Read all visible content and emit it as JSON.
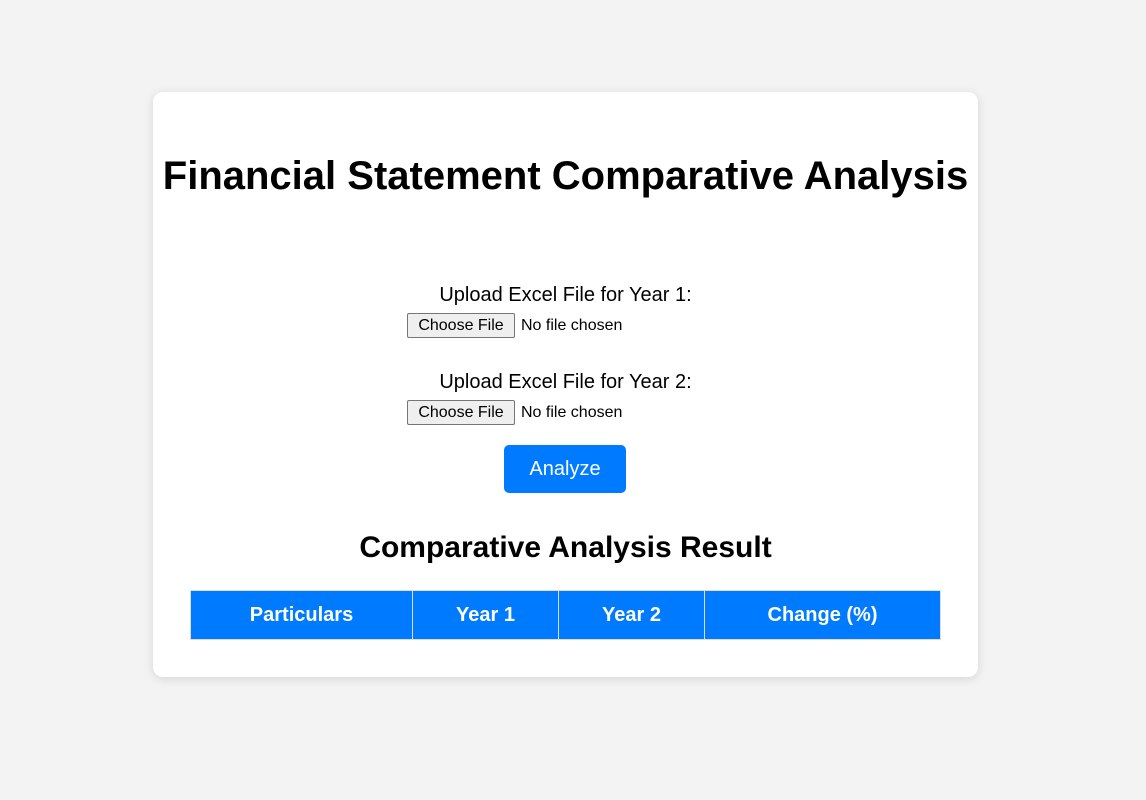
{
  "page": {
    "title": "Financial Statement Comparative Analysis"
  },
  "uploads": [
    {
      "label": "Upload Excel File for Year 1:",
      "button_label": "Choose File",
      "status": "No file chosen"
    },
    {
      "label": "Upload Excel File for Year 2:",
      "button_label": "Choose File",
      "status": "No file chosen"
    }
  ],
  "analyze": {
    "label": "Analyze"
  },
  "result": {
    "title": "Comparative Analysis Result",
    "columns": [
      "Particulars",
      "Year 1",
      "Year 2",
      "Change (%)"
    ],
    "rows": []
  },
  "colors": {
    "accent": "#007bff",
    "background": "#f3f3f3",
    "card": "#ffffff"
  }
}
